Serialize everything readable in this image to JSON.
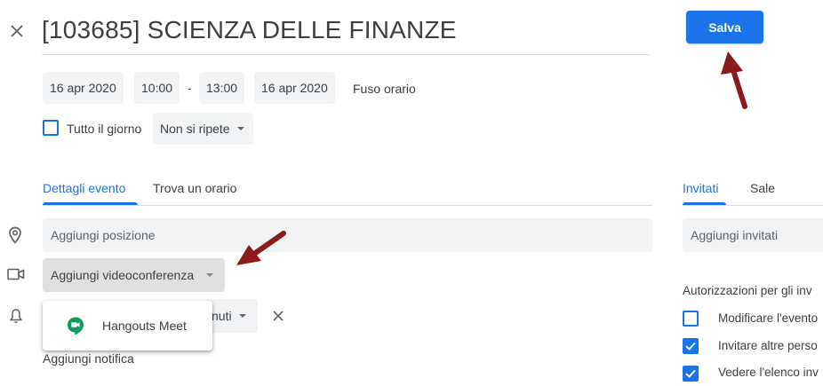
{
  "header": {
    "title": "[103685] SCIENZA DELLE FINANZE",
    "save_label": "Salva"
  },
  "datetime": {
    "start_date": "16 apr 2020",
    "start_time": "10:00",
    "separator": "-",
    "end_time": "13:00",
    "end_date": "16 apr 2020",
    "timezone_label": "Fuso orario"
  },
  "options": {
    "all_day_label": "Tutto il giorno",
    "all_day_checked": false,
    "repeat_value": "Non si ripete"
  },
  "tabs": {
    "details_label": "Dettagli evento",
    "find_time_label": "Trova un orario"
  },
  "details": {
    "location_placeholder": "Aggiungi posizione",
    "videoconference_label": "Aggiungi videoconferenza",
    "notification_value_partial": "nuti",
    "add_notification_label": "Aggiungi notifica"
  },
  "conference_menu": {
    "items": [
      {
        "label": "Hangouts Meet",
        "icon": "hangouts-meet-icon"
      }
    ]
  },
  "guests": {
    "tab_guests_label": "Invitati",
    "tab_rooms_label": "Sale",
    "add_guests_placeholder": "Aggiungi invitati",
    "permissions_heading": "Autorizzazioni per gli inv",
    "permissions": [
      {
        "label": "Modificare l'evento",
        "checked": false
      },
      {
        "label": "Invitare altre perso",
        "checked": true
      },
      {
        "label": "Vedere l'elenco inv",
        "checked": true
      }
    ]
  },
  "colors": {
    "accent": "#1a73e8",
    "annotation_arrow": "#8b1a1a"
  }
}
